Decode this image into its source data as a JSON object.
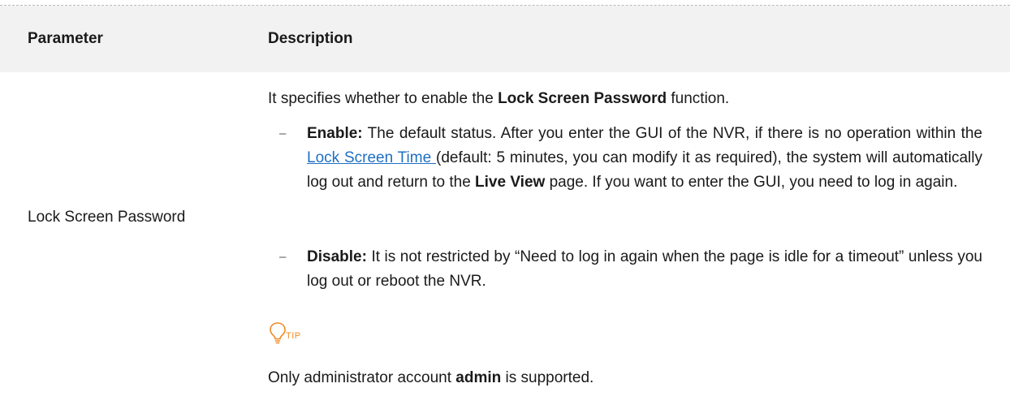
{
  "table": {
    "headers": {
      "parameter": "Parameter",
      "description": "Description"
    },
    "row": {
      "parameter": "Lock Screen Password",
      "intro": {
        "before": "It specifies whether to enable the ",
        "bold": "Lock Screen Password",
        "after": " function."
      },
      "bullet_marker": "–",
      "enable": {
        "term": "Enable:",
        "text1": " The default status. After you enter the GUI of the NVR, if there is no operation within the ",
        "link": "Lock Screen Time ",
        "text2": "(default: 5 minutes, you can modify it as required), the system will automatically log out and return to the ",
        "bold": "Live View",
        "text3": " page. If you want to enter the GUI, you need to log in again."
      },
      "disable": {
        "term": "Disable:",
        "text": " It is not restricted by “Need to log in again when the page is idle for a timeout” unless you log out or reboot the NVR."
      },
      "tip": {
        "icon": "lightbulb-icon",
        "label": "TIP",
        "color": "#f08a24",
        "note_before": "Only administrator account ",
        "note_bold": "admin",
        "note_after": " is supported."
      }
    }
  },
  "colors": {
    "header_background": "#f2f2f2",
    "link": "#1f6fc4",
    "text": "#1a1a1a"
  }
}
